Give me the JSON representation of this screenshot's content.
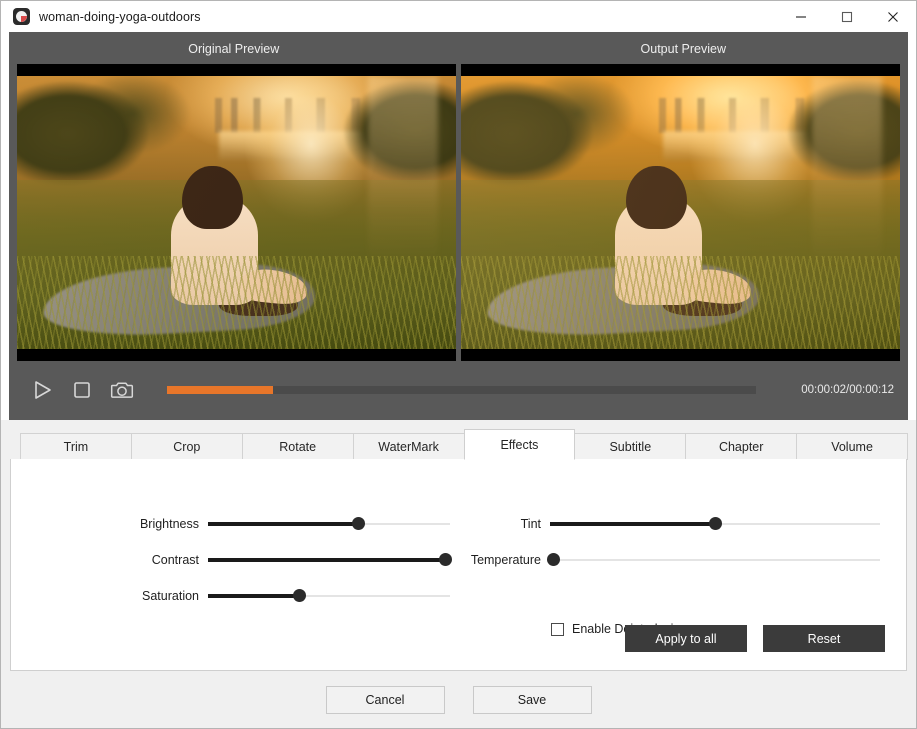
{
  "window": {
    "title": "woman-doing-yoga-outdoors",
    "icon": "media-disc-icon",
    "controls": {
      "minimize": "minimize-icon",
      "maximize": "maximize-icon",
      "close": "close-icon"
    }
  },
  "preview": {
    "original_label": "Original Preview",
    "output_label": "Output Preview",
    "scene_description": "woman meditating in grass at sunset"
  },
  "transport": {
    "play": "play-icon",
    "stop": "stop-icon",
    "snapshot": "camera-icon",
    "progress_percent": 18,
    "progress_color": "#e8762a",
    "timecode": "00:00:02/00:00:12"
  },
  "tabs": [
    {
      "label": "Trim",
      "active": false
    },
    {
      "label": "Crop",
      "active": false
    },
    {
      "label": "Rotate",
      "active": false
    },
    {
      "label": "WaterMark",
      "active": false
    },
    {
      "label": "Effects",
      "active": true
    },
    {
      "label": "Subtitle",
      "active": false
    },
    {
      "label": "Chapter",
      "active": false
    },
    {
      "label": "Volume",
      "active": false
    }
  ],
  "effects": {
    "sliders": [
      {
        "label": "Brightness",
        "value": 62,
        "column": "left"
      },
      {
        "label": "Tint",
        "value": 50,
        "column": "right"
      },
      {
        "label": "Contrast",
        "value": 98,
        "column": "left"
      },
      {
        "label": "Temperature",
        "value": 1,
        "column": "right"
      },
      {
        "label": "Saturation",
        "value": 38,
        "column": "left"
      }
    ],
    "deinterlacing": {
      "label": "Enable Deinterlacing",
      "checked": false
    },
    "apply_to_all_label": "Apply to all",
    "reset_label": "Reset"
  },
  "footer": {
    "cancel_label": "Cancel",
    "save_label": "Save"
  },
  "colors": {
    "panel_dark": "#595959",
    "accent_orange": "#e8762a",
    "button_dark": "#3b3b3b",
    "content_light": "#f0f0f0"
  }
}
